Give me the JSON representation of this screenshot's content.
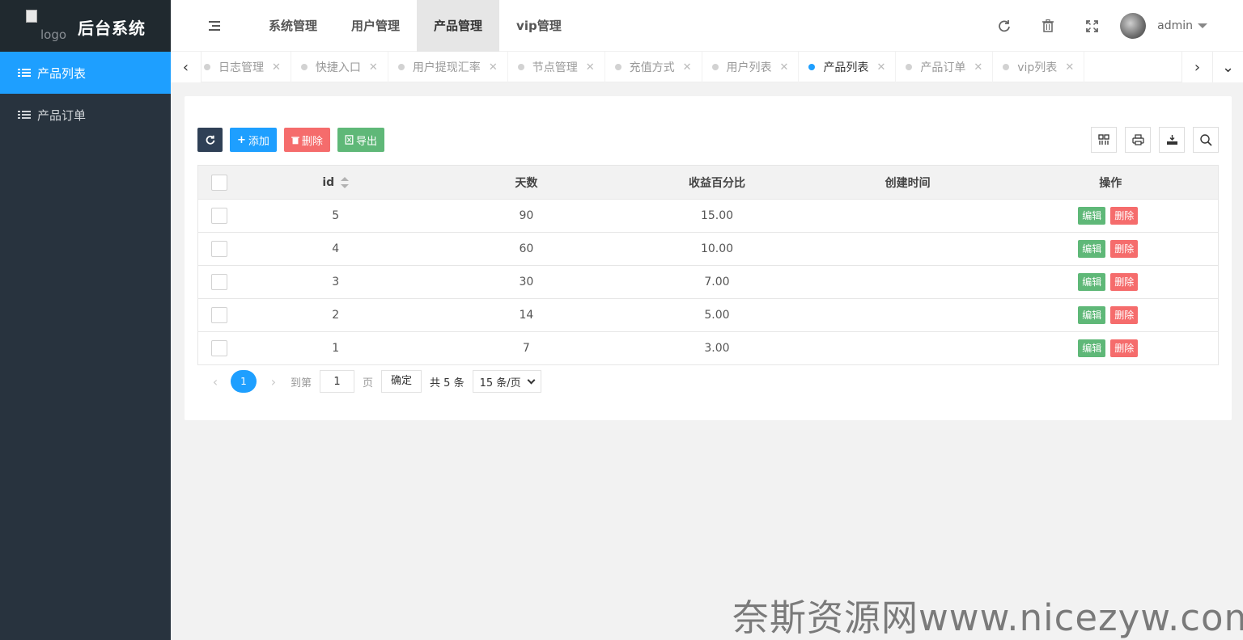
{
  "app": {
    "logo_alt": "logo",
    "title": "后台系统"
  },
  "sidebar": {
    "items": [
      {
        "label": "产品列表",
        "active": true
      },
      {
        "label": "产品订单",
        "active": false
      }
    ]
  },
  "header": {
    "nav": [
      {
        "label": "系统管理"
      },
      {
        "label": "用户管理"
      },
      {
        "label": "产品管理",
        "active": true
      },
      {
        "label": "vip管理"
      }
    ],
    "icons": [
      "refresh-icon",
      "trash-icon",
      "fullscreen-icon"
    ],
    "user": "admin"
  },
  "tabs": [
    {
      "label": "日志管理"
    },
    {
      "label": "快捷入口"
    },
    {
      "label": "用户提现汇率"
    },
    {
      "label": "节点管理"
    },
    {
      "label": "充值方式"
    },
    {
      "label": "用户列表"
    },
    {
      "label": "产品列表",
      "active": true
    },
    {
      "label": "产品订单"
    },
    {
      "label": "vip列表"
    }
  ],
  "toolbar": {
    "add": "添加",
    "delete": "删除",
    "export": "导出"
  },
  "table": {
    "headers": [
      "id",
      "天数",
      "收益百分比",
      "创建时间",
      "操作"
    ],
    "rows": [
      {
        "id": "5",
        "days": "90",
        "percent": "15.00",
        "created": ""
      },
      {
        "id": "4",
        "days": "60",
        "percent": "10.00",
        "created": ""
      },
      {
        "id": "3",
        "days": "30",
        "percent": "7.00",
        "created": ""
      },
      {
        "id": "2",
        "days": "14",
        "percent": "5.00",
        "created": ""
      },
      {
        "id": "1",
        "days": "7",
        "percent": "3.00",
        "created": ""
      }
    ],
    "edit_label": "编辑",
    "delete_label": "删除"
  },
  "pager": {
    "current": "1",
    "goto_label": "到第",
    "goto_value": "1",
    "page_unit": "页",
    "confirm": "确定",
    "total": "共 5 条",
    "per_page": "15 条/页"
  },
  "watermark": "奈斯资源网www.nicezyw.com",
  "colors": {
    "accent": "#1e9fff",
    "sidebar_bg": "#28333e",
    "edit_green": "#5fb878",
    "delete_red": "#f56c6c"
  }
}
